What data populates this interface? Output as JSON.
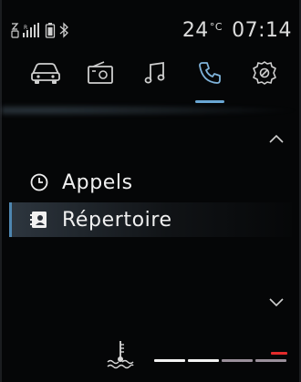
{
  "status": {
    "temperature": "24",
    "temperature_unit": "°C",
    "time": "07:14",
    "icons": [
      "sim-icon",
      "signal-icon",
      "battery-icon",
      "bluetooth-icon"
    ]
  },
  "tabs": [
    {
      "name": "car-icon",
      "active": false
    },
    {
      "name": "radio-icon",
      "active": false
    },
    {
      "name": "music-icon",
      "active": false
    },
    {
      "name": "phone-icon",
      "active": true
    },
    {
      "name": "settings-icon",
      "active": false
    }
  ],
  "menu": {
    "items": [
      {
        "label": "Appels",
        "icon": "clock-icon",
        "selected": false
      },
      {
        "label": "Répertoire",
        "icon": "contacts-icon",
        "selected": true
      }
    ]
  },
  "gauge": {
    "icon": "coolant-temperature-icon",
    "segment_colors": [
      "#f2f2f2",
      "#f2f2f2",
      "#9a8f9a",
      "#9a8f9a"
    ],
    "warning_color": "#e32b2b"
  }
}
